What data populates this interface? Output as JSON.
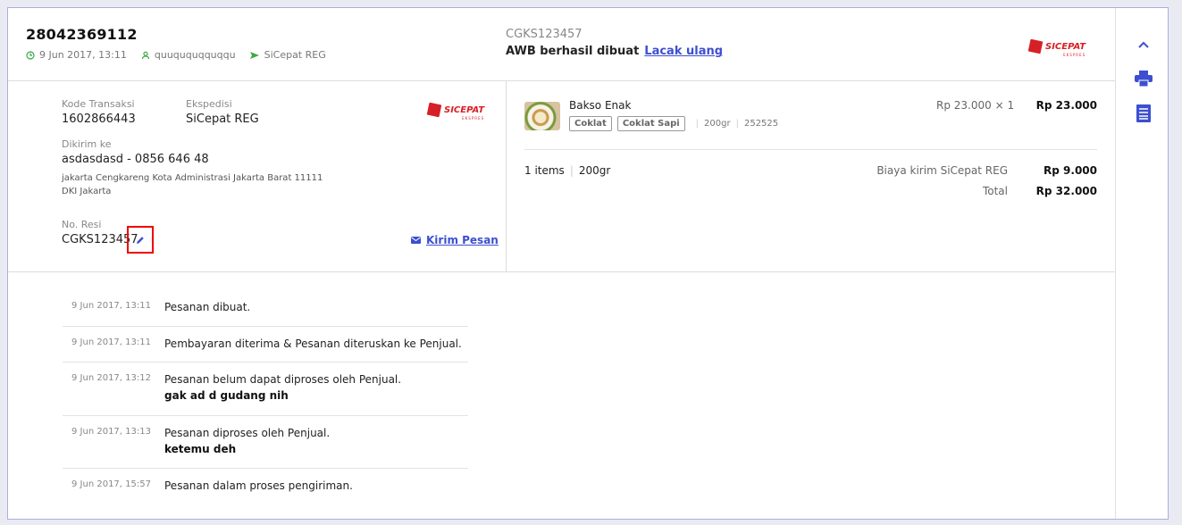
{
  "header": {
    "order_number": "28042369112",
    "date": "9 Jun 2017, 13:11",
    "buyer": "quuququqquqqu",
    "courier": "SiCepat REG",
    "awb_code": "CGKS123457",
    "awb_status": "AWB berhasil dibuat",
    "retrack_link": "Lacak ulang"
  },
  "logo": {
    "brand": "SICEPAT",
    "tagline": "EKSPRES",
    "color": "#d62027"
  },
  "shipment": {
    "transaction_label": "Kode Transaksi",
    "transaction_value": "1602866443",
    "expedition_label": "Ekspedisi",
    "expedition_value": "SiCepat REG",
    "sent_to_label": "Dikirim ke",
    "recipient": "asdasdasd - 0856 646 48",
    "address_line1": "jakarta Cengkareng Kota Administrasi Jakarta Barat 11111",
    "address_line2": "DKI Jakarta",
    "receipt_label": "No. Resi",
    "receipt_value": "CGKS123457",
    "send_message": "Kirim Pesan"
  },
  "product": {
    "name": "Bakso Enak",
    "tags": [
      "Coklat",
      "Coklat Sapi"
    ],
    "weight": "200gr",
    "sku": "252525",
    "unit_price": "Rp 23.000 × 1",
    "subtotal": "Rp 23.000"
  },
  "summary": {
    "items": "1 items",
    "weight": "200gr",
    "shipping_label": "Biaya kirim SiCepat REG",
    "shipping_value": "Rp 9.000",
    "total_label": "Total",
    "total_value": "Rp 32.000"
  },
  "history": [
    {
      "time": "9 Jun 2017, 13:11",
      "message": "Pesanan dibuat.",
      "note": ""
    },
    {
      "time": "9 Jun 2017, 13:11",
      "message": "Pembayaran diterima & Pesanan diteruskan ke Penjual.",
      "note": ""
    },
    {
      "time": "9 Jun 2017, 13:12",
      "message": "Pesanan belum dapat diproses oleh Penjual.",
      "note": "gak ad d gudang nih"
    },
    {
      "time": "9 Jun 2017, 13:13",
      "message": "Pesanan diproses oleh Penjual.",
      "note": "ketemu deh"
    },
    {
      "time": "9 Jun 2017, 15:57",
      "message": "Pesanan dalam proses pengiriman.",
      "note": ""
    }
  ],
  "colors": {
    "accent": "#3d4fd0",
    "green": "#3aa843",
    "highlight": "#e00000"
  },
  "sidebar_icons": [
    "chevron-up-icon",
    "printer-icon",
    "document-list-icon"
  ]
}
